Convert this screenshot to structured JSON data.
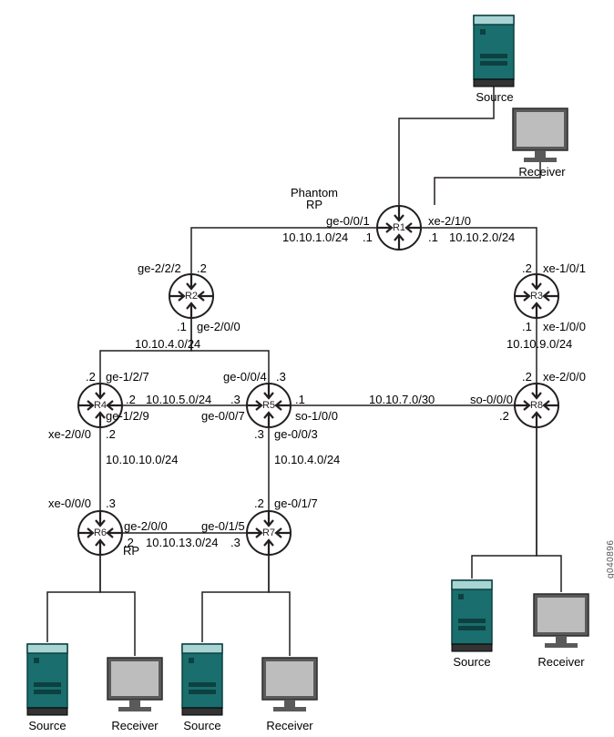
{
  "diagram_id": "g040896",
  "hosts": {
    "top_source": "Source",
    "top_receiver": "Receiver",
    "bot_left_source": "Source",
    "bot_left_receiver": "Receiver",
    "bot_mid_source": "Source",
    "bot_mid_receiver": "Receiver",
    "bot_right_source": "Source",
    "bot_right_receiver": "Receiver"
  },
  "annot": {
    "phantom_rp": "Phantom\nRP",
    "rp": "RP"
  },
  "routers": {
    "r1": "R1",
    "r2": "R2",
    "r3": "R3",
    "r4": "R4",
    "r5": "R5",
    "r6": "R6",
    "r7": "R7",
    "r8": "R8"
  },
  "labels": {
    "r1_ge001": "ge-0/0/1",
    "r1_xe210": "xe-2/1/0",
    "r1_left_net": "10.10.1.0/24",
    "r1_left_host": ".1",
    "r1_right_host": ".1",
    "r1_right_net": "10.10.2.0/24",
    "r2_ge222": "ge-2/2/2",
    "r2_top_host": ".2",
    "r2_bot_host": ".1",
    "r2_ge200": "ge-2/0/0",
    "r2_net": "10.10.4.0/24",
    "r3_top_host": ".2",
    "r3_xe101": "xe-1/0/1",
    "r3_bot_host": ".1",
    "r3_xe100": "xe-1/0/0",
    "r3_net": "10.10.9.0/24",
    "r4_ge127": "ge-1/2/7",
    "r4_top_host": ".2",
    "r4_right_host": ".2",
    "r45_net": "10.10.5.0/24",
    "r4_ge129": "ge-1/2/9",
    "r4_xe200": "xe-2/0/0",
    "r4_bot_host": ".2",
    "r4_net_down": "10.10.10.0/24",
    "r5_ge004": "ge-0/0/4",
    "r5_top_host": ".3",
    "r5_left_host": ".3",
    "r5_ge007": "ge-0/0/7",
    "r5_right_host": ".1",
    "r5_so100": "so-1/0/0",
    "r5_bot_host": ".3",
    "r5_ge003": "ge-0/0/3",
    "r5_net_down": "10.10.4.0/24",
    "r57_net": "10.10.7.0/30",
    "r6_xe000": "xe-0/0/0",
    "r6_top_host": ".3",
    "r6_ge200": "ge-2/0/0",
    "r6_right_host": ".2",
    "r67_net": "10.10.13.0/24",
    "r7_ge015": "ge-0/1/5",
    "r7_left_host": ".3",
    "r7_ge017": "ge-0/1/7",
    "r7_top_host": ".2",
    "r8_xe200": "xe-2/0/0",
    "r8_top_host": ".2",
    "r8_so000": "so-0/0/0",
    "r8_left_host": ".2"
  }
}
